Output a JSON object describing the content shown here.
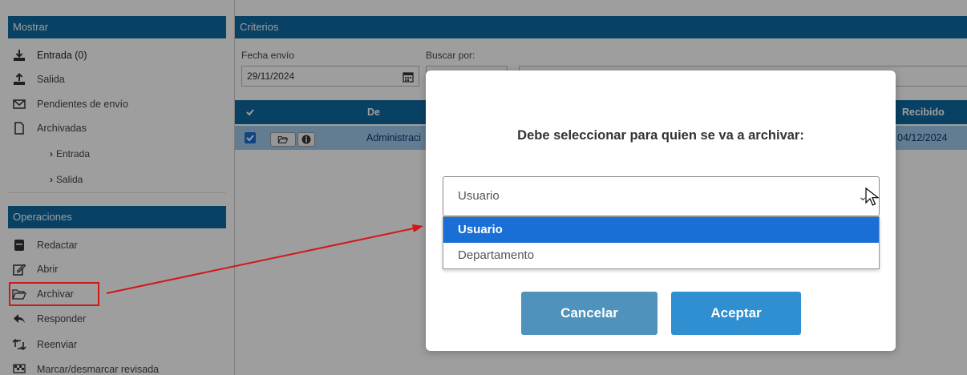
{
  "sidebar": {
    "mostrar_title": "Mostrar",
    "items": [
      {
        "label": "Entrada (0)",
        "icon": "download-icon"
      },
      {
        "label": "Salida",
        "icon": "upload-icon"
      },
      {
        "label": "Pendientes de envío",
        "icon": "envelope-icon"
      },
      {
        "label": "Archivadas",
        "icon": "file-icon"
      }
    ],
    "sub_items": [
      "Entrada",
      "Salida"
    ],
    "operaciones_title": "Operaciones",
    "operations": [
      {
        "label": "Redactar",
        "icon": "compose-icon"
      },
      {
        "label": "Abrir",
        "icon": "edit-icon"
      },
      {
        "label": "Archivar",
        "icon": "folder-open-icon"
      },
      {
        "label": "Responder",
        "icon": "reply-icon"
      },
      {
        "label": "Reenviar",
        "icon": "forward-icon"
      },
      {
        "label": "Marcar/desmarcar revisada",
        "icon": "flag-icon"
      }
    ]
  },
  "main": {
    "criterios_title": "Criterios",
    "fecha_label": "Fecha envío",
    "fecha_value": "29/11/2024",
    "buscar_label": "Buscar por:",
    "table": {
      "headers": {
        "de": "De",
        "recibido": "Recibido"
      },
      "row": {
        "de": "Administraci",
        "recibido": "04/12/2024"
      }
    }
  },
  "modal": {
    "title": "Debe seleccionar para quien se va a archivar:",
    "select_value": "Usuario",
    "options": [
      "Usuario",
      "Departamento"
    ],
    "cancel_label": "Cancelar",
    "accept_label": "Aceptar"
  },
  "colors": {
    "header_blue": "#0e6aa0",
    "row_selected": "#9ec9ea",
    "option_selected": "#1a6fd6",
    "cancel_button": "#4f93bd",
    "accept_button": "#2f8fd0",
    "annotation_red": "#d11818"
  }
}
